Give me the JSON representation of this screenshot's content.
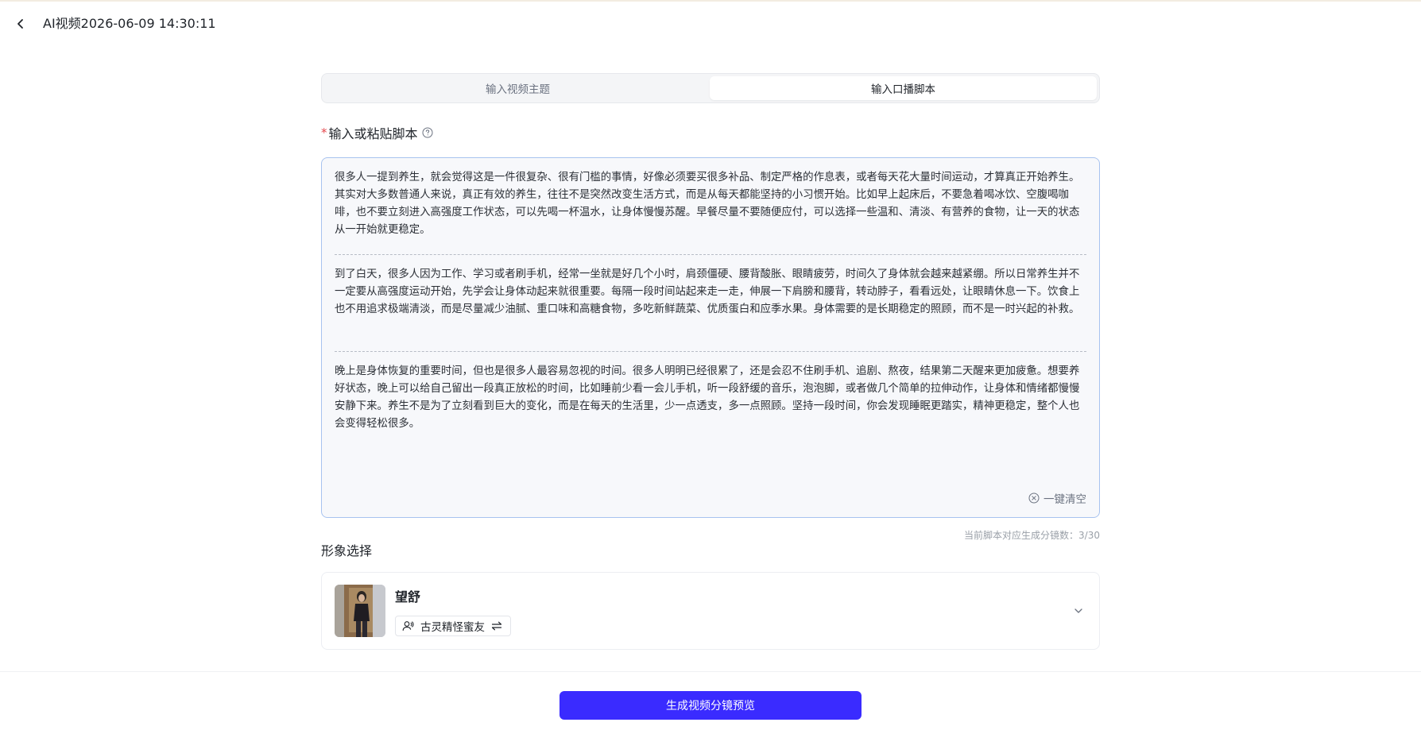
{
  "header": {
    "title": "AI视频2026-06-09 14:30:11"
  },
  "tabs": [
    {
      "label": "输入视频主题",
      "active": false
    },
    {
      "label": "输入口播脚本",
      "active": true
    }
  ],
  "script_field": {
    "label": "输入或粘贴脚本",
    "required_mark": "*",
    "paragraphs": [
      "很多人一提到养生，就会觉得这是一件很复杂、很有门槛的事情，好像必须要买很多补品、制定严格的作息表，或者每天花大量时间运动，才算真正开始养生。其实对大多数普通人来说，真正有效的养生，往往不是突然改变生活方式，而是从每天都能坚持的小习惯开始。比如早上起床后，不要急着喝冰饮、空腹喝咖啡，也不要立刻进入高强度工作状态，可以先喝一杯温水，让身体慢慢苏醒。早餐尽量不要随便应付，可以选择一些温和、清淡、有营养的食物，让一天的状态从一开始就更稳定。",
      "到了白天，很多人因为工作、学习或者刷手机，经常一坐就是好几个小时，肩颈僵硬、腰背酸胀、眼睛疲劳，时间久了身体就会越来越紧绷。所以日常养生并不一定要从高强度运动开始，先学会让身体动起来就很重要。每隔一段时间站起来走一走，伸展一下肩膀和腰背，转动脖子，看看远处，让眼睛休息一下。饮食上也不用追求极端清淡，而是尽量减少油腻、重口味和高糖食物，多吃新鲜蔬菜、优质蛋白和应季水果。身体需要的是长期稳定的照顾，而不是一时兴起的补救。",
      "晚上是身体恢复的重要时间，但也是很多人最容易忽视的时间。很多人明明已经很累了，还是会忍不住刷手机、追剧、熬夜，结果第二天醒来更加疲惫。想要养好状态，晚上可以给自己留出一段真正放松的时间，比如睡前少看一会儿手机，听一段舒缓的音乐，泡泡脚，或者做几个简单的拉伸动作，让身体和情绪都慢慢安静下来。养生不是为了立刻看到巨大的变化，而是在每天的生活里，少一点透支，多一点照顾。坚持一段时间，你会发现睡眠更踏实，精神更稳定，整个人也会变得轻松很多。"
    ],
    "clear_label": "一键清空",
    "shot_count_text": "当前脚本对应生成分镜数：3/30"
  },
  "avatar_section": {
    "title": "形象选择",
    "selected": {
      "name": "望舒",
      "style_tag": "古灵精怪蜜友"
    }
  },
  "footer": {
    "generate_label": "生成视频分镜预览"
  },
  "colors": {
    "primary": "#3a2bff",
    "editor_border": "#a8c3ef",
    "editor_bg": "#f7f8fb",
    "required": "#e5484d"
  }
}
